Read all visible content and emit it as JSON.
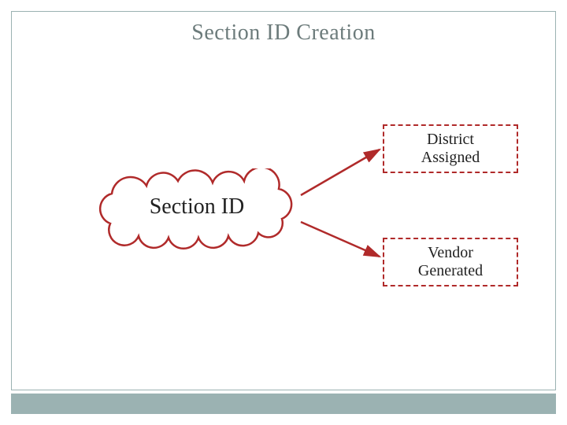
{
  "title": "Section ID Creation",
  "cloud_label": "Section ID",
  "boxes": {
    "top": "District\nAssigned",
    "bottom": "Vendor\nGenerated"
  },
  "colors": {
    "frame": "#9bb2b2",
    "accent": "#b02a2a",
    "title": "#6c7b7b"
  }
}
